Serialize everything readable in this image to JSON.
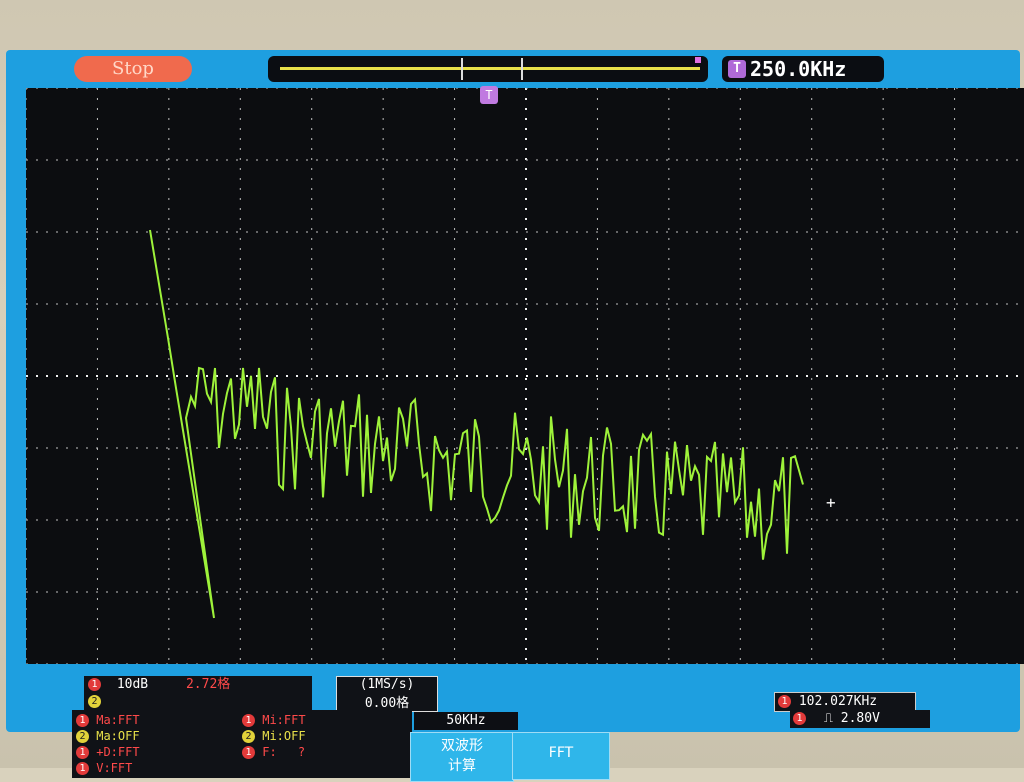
{
  "topbar": {
    "run_state": "Stop",
    "trigger_badge": "T",
    "trigger_freq": "250.0KHz"
  },
  "trigger_marker": "T",
  "channel1": {
    "badge": "1",
    "scale": "10dB",
    "position": "2.72格"
  },
  "channel2": {
    "badge": "2"
  },
  "timebase": {
    "scale": "(1MS/s)",
    "offset": "0.00格"
  },
  "freq_counter": {
    "badge": "1",
    "value": "102.027KHz"
  },
  "trigger_level": {
    "badge": "1",
    "value": "2.80V"
  },
  "math_panel": {
    "ma1": "Ma:FFT",
    "ma2": "Ma:OFF",
    "plusd": "+D:FFT",
    "v": "V:FFT",
    "mi1": "Mi:FFT",
    "mi2": "Mi:OFF",
    "f": "F:",
    "f_value": "?"
  },
  "fft": {
    "span": "50KHz",
    "softkey_left": "双波形\n计算",
    "softkey_right": "FFT"
  },
  "colors": {
    "trace": "#9ef23a",
    "screen_bezel": "#1e9fe0",
    "grid": "#d8d8d8"
  },
  "icons": [
    "cursor-crosshair-icon",
    "trigger-t-icon",
    "rising-edge-icon"
  ]
}
